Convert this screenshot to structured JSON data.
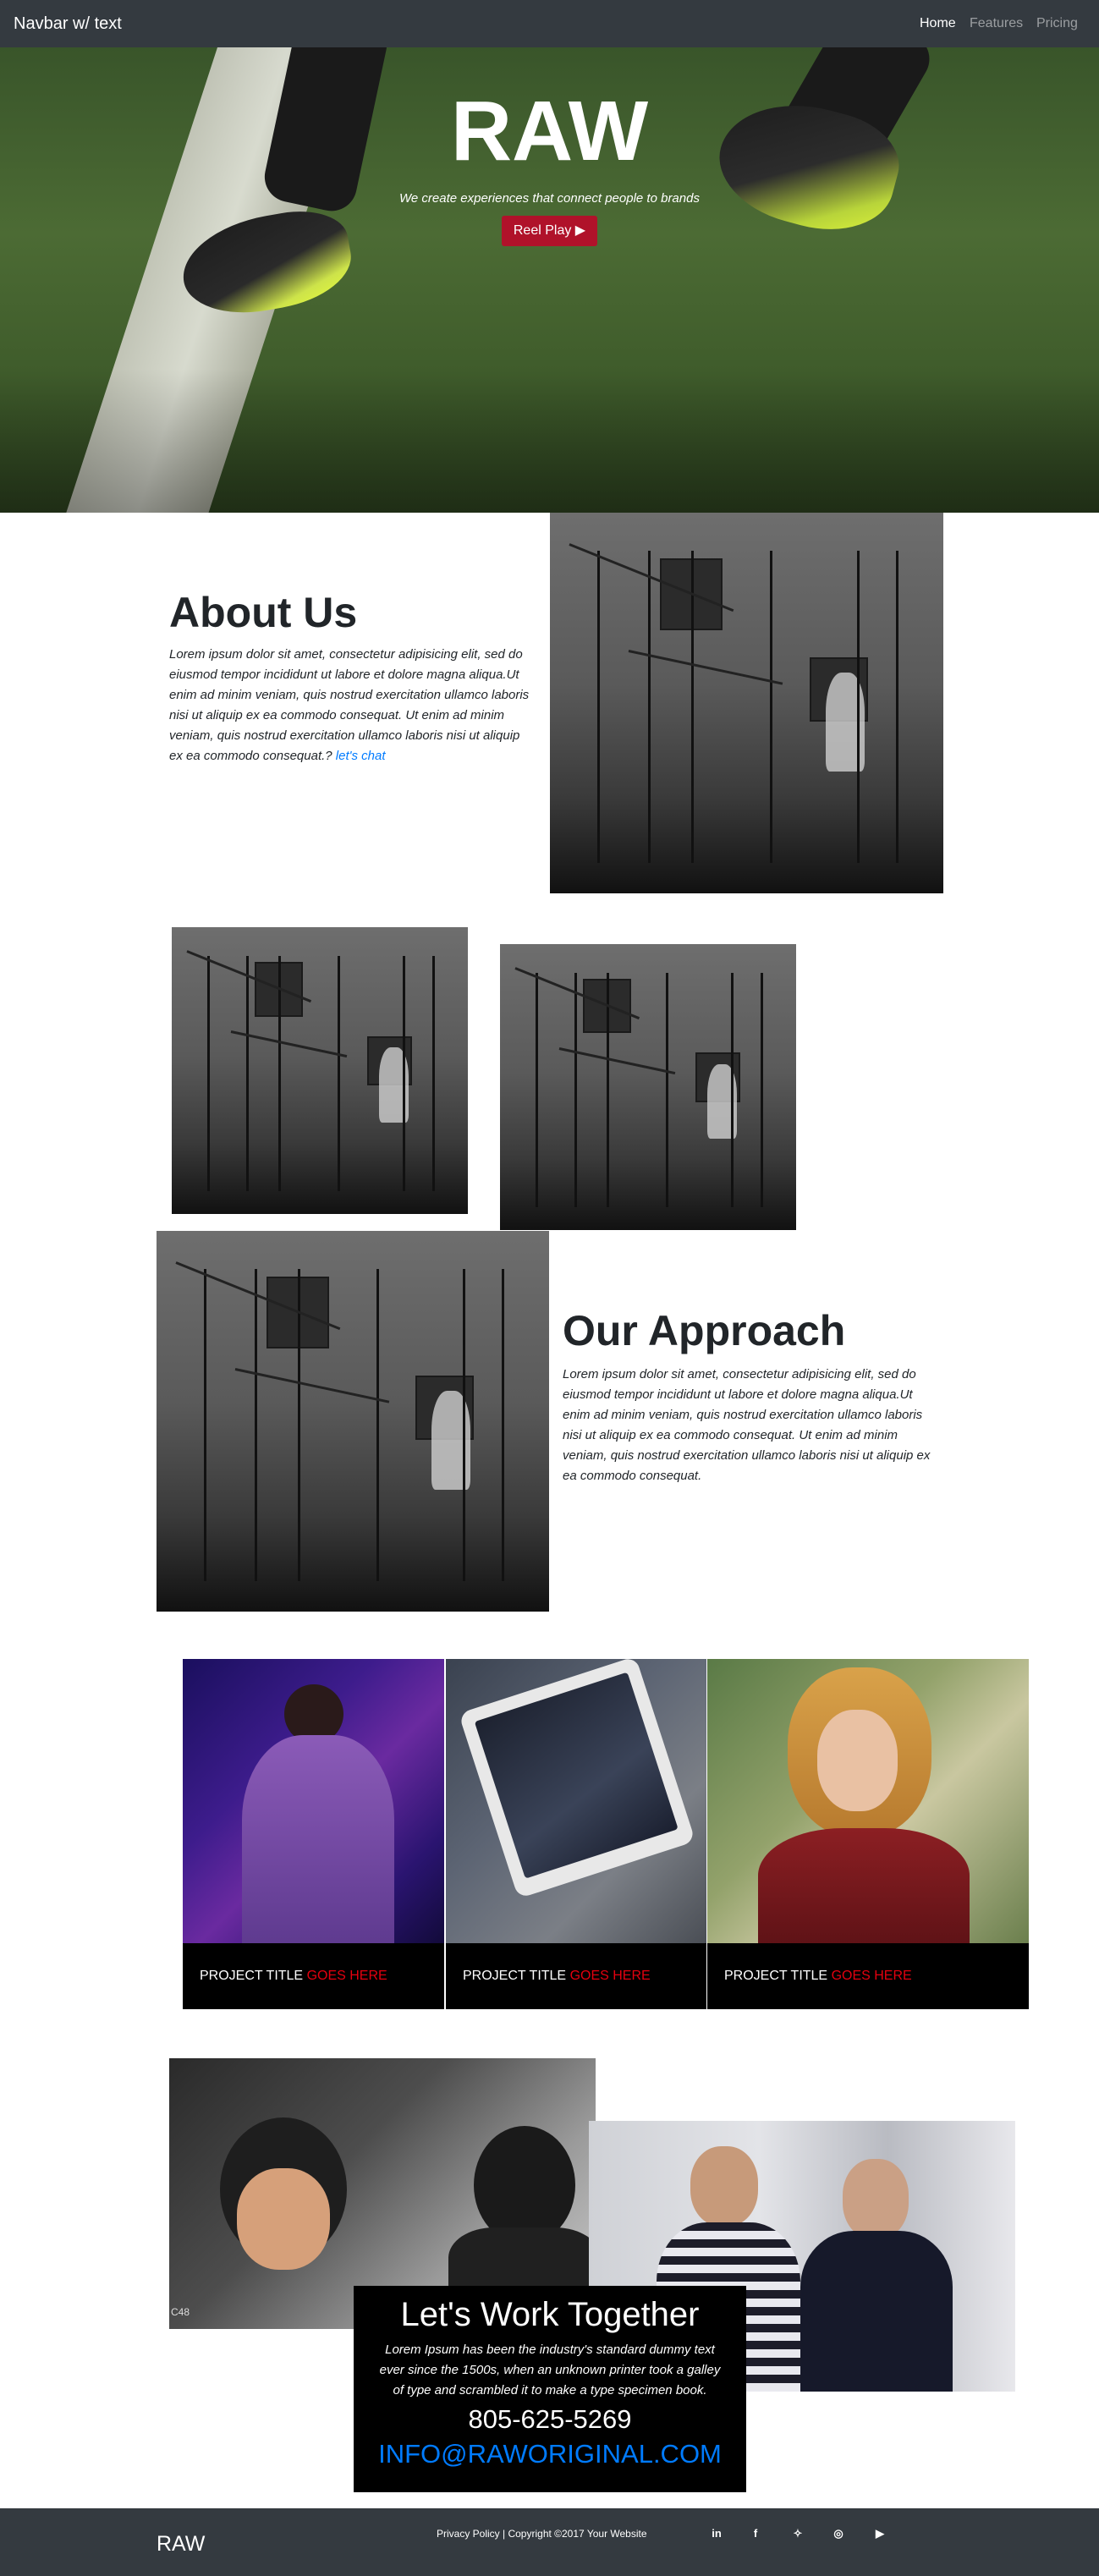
{
  "navbar": {
    "brand": "Navbar w/ text",
    "links": [
      {
        "label": "Home",
        "active": true
      },
      {
        "label": "Features",
        "active": false
      },
      {
        "label": "Pricing",
        "active": false
      }
    ]
  },
  "hero": {
    "title": "RAW",
    "subtitle": "We create experiences that connect people to brands",
    "button_label": "Reel Play ▶"
  },
  "about": {
    "title": "About Us",
    "text": "Lorem ipsum dolor sit amet, consectetur adipisicing elit, sed do eiusmod tempor incididunt ut labore et dolore magna aliqua.Ut enim ad minim veniam, quis nostrud exercitation ullamco laboris nisi ut aliquip ex ea commodo consequat. Ut enim ad minim veniam, quis nostrud exercitation ullamco laboris nisi ut aliquip ex ea commodo consequat.?",
    "link": "let's chat"
  },
  "approach": {
    "title": "Our Approach",
    "text": "Lorem ipsum dolor sit amet, consectetur adipisicing elit, sed do eiusmod tempor incididunt ut labore et dolore magna aliqua.Ut enim ad minim veniam, quis nostrud exercitation ullamco laboris nisi ut aliquip ex ea commodo consequat. Ut enim ad minim veniam, quis nostrud exercitation ullamco laboris nisi ut aliquip ex ea commodo consequat."
  },
  "projects": [
    {
      "title": "PROJECT TITLE",
      "highlight": "GOES HERE"
    },
    {
      "title": "PROJECT TITLE",
      "highlight": "GOES HERE"
    },
    {
      "title": "PROJECT TITLE",
      "highlight": "GOES HERE"
    }
  ],
  "work": {
    "title": "Let's Work Together",
    "text": "Lorem Ipsum has been the industry's standard dummy text ever since the 1500s, when an unknown printer took a galley of type and scrambled it to make a type specimen book.",
    "phone": "805-625-5269",
    "email": "INFO@RAWORIGINAL.COM",
    "image_caption": "C48"
  },
  "footer": {
    "brand": "RAW",
    "copyright": "Privacy Policy | Copyright ©2017 Your Website",
    "social": [
      {
        "icon": "linkedin-icon",
        "glyph": "in"
      },
      {
        "icon": "facebook-icon",
        "glyph": "f"
      },
      {
        "icon": "twitter-icon",
        "glyph": "✧"
      },
      {
        "icon": "instagram-icon",
        "glyph": "◎"
      },
      {
        "icon": "youtube-icon",
        "glyph": "▶"
      }
    ]
  },
  "colors": {
    "navbar_bg": "#343a40",
    "accent_red": "#b0122a",
    "link_blue": "#007bff",
    "caption_red": "#e4000f"
  }
}
